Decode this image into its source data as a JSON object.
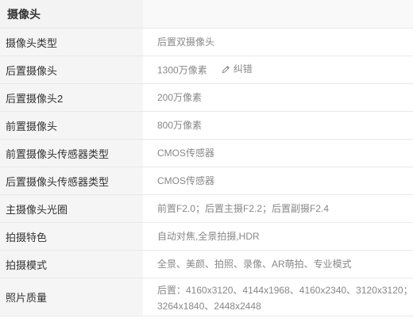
{
  "section": {
    "title": "摄像头"
  },
  "rows": [
    {
      "label": "摄像头类型",
      "value": "后置双摄像头"
    },
    {
      "label": "后置摄像头",
      "value": "1300万像素",
      "action_label": "纠错"
    },
    {
      "label": "后置摄像头2",
      "value": "200万像素"
    },
    {
      "label": "前置摄像头",
      "value": "800万像素"
    },
    {
      "label": "前置摄像头传感器类型",
      "value": "CMOS传感器"
    },
    {
      "label": "后置摄像头传感器类型",
      "value": "CMOS传感器"
    },
    {
      "label": "主摄像头光圈",
      "value": "前置F2.0；后置主摄F2.2；后置副摄F2.4"
    },
    {
      "label": "拍摄特色",
      "value": "自动对焦,全景拍摄,HDR"
    },
    {
      "label": "拍摄模式",
      "value": "全景、美颜、拍照、录像、AR萌拍、专业模式"
    },
    {
      "label": "照片质量",
      "value_line1": "后置：4160x3120、4144x1968、4160x2340、3120x3120；",
      "value_line2": "3264x1840、2448x2448"
    }
  ],
  "icons": {
    "correction": "pencil-icon"
  }
}
